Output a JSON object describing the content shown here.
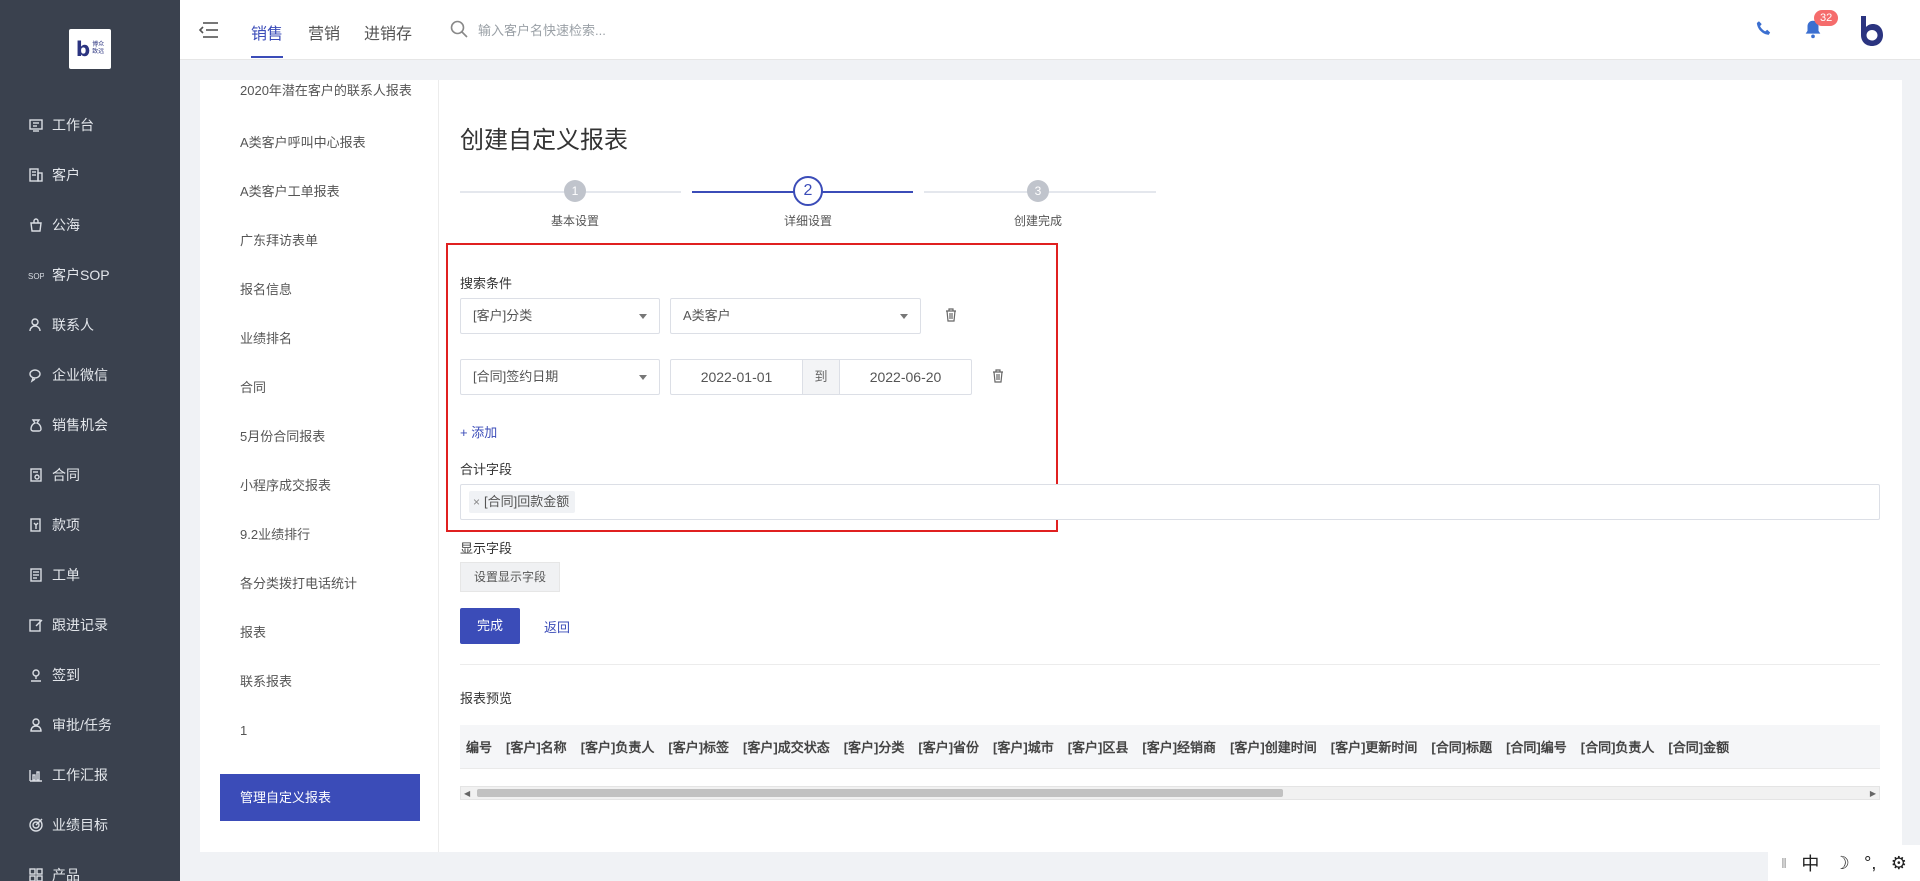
{
  "brand": {
    "logo_letter": "b",
    "logo_text_line1": "博众",
    "logo_text_line2": "致远"
  },
  "nav": {
    "items": [
      {
        "label": "工作台",
        "icon": "monitor-icon"
      },
      {
        "label": "客户",
        "icon": "building-icon"
      },
      {
        "label": "公海",
        "icon": "bag-icon"
      },
      {
        "label": "客户SOP",
        "icon": "sop-icon"
      },
      {
        "label": "联系人",
        "icon": "contacts-icon"
      },
      {
        "label": "企业微信",
        "icon": "wechat-icon"
      },
      {
        "label": "销售机会",
        "icon": "moneybag-icon"
      },
      {
        "label": "合同",
        "icon": "contract-icon"
      },
      {
        "label": "款项",
        "icon": "payment-icon"
      },
      {
        "label": "工单",
        "icon": "ticket-icon"
      },
      {
        "label": "跟进记录",
        "icon": "edit-icon"
      },
      {
        "label": "签到",
        "icon": "checkin-icon"
      },
      {
        "label": "审批/任务",
        "icon": "approval-icon"
      },
      {
        "label": "工作汇报",
        "icon": "report-icon"
      },
      {
        "label": "业绩目标",
        "icon": "target-icon"
      },
      {
        "label": "产品",
        "icon": "product-icon"
      }
    ]
  },
  "topbar": {
    "tabs": [
      "销售",
      "营销",
      "进销存"
    ],
    "active_tab": "销售",
    "search_placeholder": "输入客户名快速检索...",
    "notification_count": "32"
  },
  "sidebar_reports": {
    "items": [
      "2020年潜在客户的联系人报表",
      "A类客户呼叫中心报表",
      "A类客户工单报表",
      "广东拜访表单",
      "报名信息",
      "业绩排名",
      "合同",
      "5月份合同报表",
      "小程序成交报表",
      "9.2业绩排行",
      "各分类拨打电话统计",
      "报表",
      "联系报表",
      "1"
    ],
    "active_item": "管理自定义报表"
  },
  "page": {
    "title": "创建自定义报表",
    "steps": [
      {
        "num": "1",
        "label": "基本设置"
      },
      {
        "num": "2",
        "label": "详细设置"
      },
      {
        "num": "3",
        "label": "创建完成"
      }
    ],
    "current_step": 2
  },
  "form": {
    "search_conditions_label": "搜索条件",
    "condition1_field": "[客户]分类",
    "condition1_value": "A类客户",
    "condition2_field": "[合同]签约日期",
    "date_from": "2022-01-01",
    "date_sep": "到",
    "date_to": "2022-06-20",
    "add_label": "+ 添加",
    "sum_fields_label": "合计字段",
    "sum_field_tag": "[合同]回款金额",
    "display_fields_label": "显示字段",
    "set_display_button": "设置显示字段",
    "finish_button": "完成",
    "back_link": "返回"
  },
  "preview": {
    "title": "报表预览",
    "columns": [
      "编号",
      "[客户]名称",
      "[客户]负责人",
      "[客户]标签",
      "[客户]成交状态",
      "[客户]分类",
      "[客户]省份",
      "[客户]城市",
      "[客户]区县",
      "[客户]经销商",
      "[客户]创建时间",
      "[客户]更新时间",
      "[合同]标题",
      "[合同]编号",
      "[合同]负责人",
      "[合同]金额"
    ]
  },
  "ime": {
    "lang": "中",
    "punct": "°,"
  },
  "colors": {
    "accent": "#3b4cb8",
    "nav_bg": "#3a414e",
    "highlight": "#e02020",
    "badge": "#f56c6c"
  }
}
